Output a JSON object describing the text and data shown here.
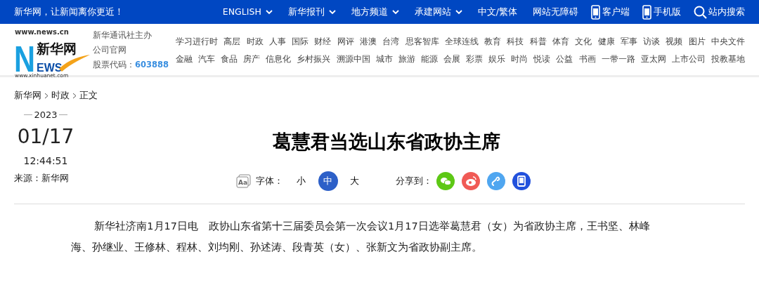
{
  "top_bar": {
    "slogan": "新华网，让新闻离你更近！",
    "links": [
      {
        "label": "ENGLISH",
        "kind": "menu"
      },
      {
        "label": "新华报刊",
        "kind": "menu"
      },
      {
        "label": "地方频道",
        "kind": "menu"
      },
      {
        "label": "承建网站",
        "kind": "menu"
      },
      {
        "label": "中文/繁体",
        "kind": "link"
      },
      {
        "label": "网站无障碍",
        "kind": "link"
      },
      {
        "label": "客户端",
        "kind": "device"
      },
      {
        "label": "手机版",
        "kind": "device"
      },
      {
        "label": "站内搜索",
        "kind": "search"
      }
    ]
  },
  "header": {
    "logo": {
      "domain": "www.news.cn",
      "name": "新华网",
      "letter": "N",
      "word": "EWS",
      "domain_alt": "www.xinhuanet.com"
    },
    "publisher": [
      "新华通讯社主办",
      "公司官网"
    ],
    "stock_label": "股票代码：",
    "stock_code": "603888",
    "channels": [
      [
        "学习进行时",
        "高层",
        "时政",
        "人事",
        "国际",
        "财经",
        "网评",
        "港澳",
        "台湾",
        "思客智库",
        "全球连线",
        "教育",
        "科技",
        "科普",
        "体育",
        "文化",
        "健康",
        "军事",
        "访谈",
        "视频",
        "图片",
        "中央文件"
      ],
      [
        "金融",
        "汽车",
        "食品",
        "房产",
        "信息化",
        "乡村振兴",
        "溯源中国",
        "城市",
        "旅游",
        "能源",
        "会展",
        "彩票",
        "娱乐",
        "时尚",
        "悦读",
        "公益",
        "书画",
        "一带一路",
        "亚太网",
        "上市公司",
        "投教基地"
      ]
    ]
  },
  "breadcrumb": [
    "新华网",
    "时政",
    "正文"
  ],
  "article": {
    "year": "2023",
    "date": "01/17",
    "time": "12:44:51",
    "source": "来源：新华网",
    "title": "葛慧君当选山东省政协主席",
    "font_icon_text": "Aa",
    "font_label": "字体：",
    "font_sizes": [
      {
        "label": "小",
        "selected": false
      },
      {
        "label": "中",
        "selected": true
      },
      {
        "label": "大",
        "selected": false
      }
    ],
    "share_label": "分享到：",
    "body": "新华社济南1月17日电　政协山东省第十三届委员会第一次会议1月17日选举葛慧君（女）为省政协主席，王书坚、林峰海、孙继业、王修林、程林、刘均刚、孙述涛、段青英（女）、张新文为省政协副主席。"
  }
}
